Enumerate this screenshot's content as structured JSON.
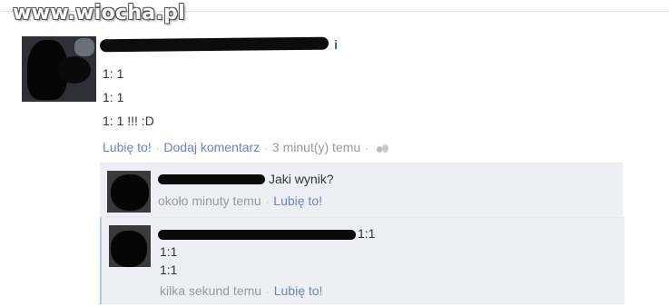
{
  "watermark": "www.wiocha.pl",
  "post": {
    "lines": [
      "1: 1",
      "1: 1",
      "1: 1 !!! :D"
    ],
    "author_tail": "i",
    "actions": {
      "like": "Lubię to!",
      "comment": "Dodaj komentarz",
      "time": "3 minut(y) temu"
    }
  },
  "comments": [
    {
      "text": "Jaki wynik?",
      "time": "około minuty temu",
      "like": "Lubię to!"
    },
    {
      "first_line": "1:1",
      "lines": [
        "1:1",
        "1:1"
      ],
      "time": "kilka sekund temu",
      "like": "Lubię to!"
    }
  ],
  "colors": {
    "link": "#6d84b4",
    "name": "#3b5998",
    "comment_bg": "#edeff4",
    "meta": "#999999"
  },
  "icons": {
    "separator": "·",
    "audience": "friends-icon"
  }
}
